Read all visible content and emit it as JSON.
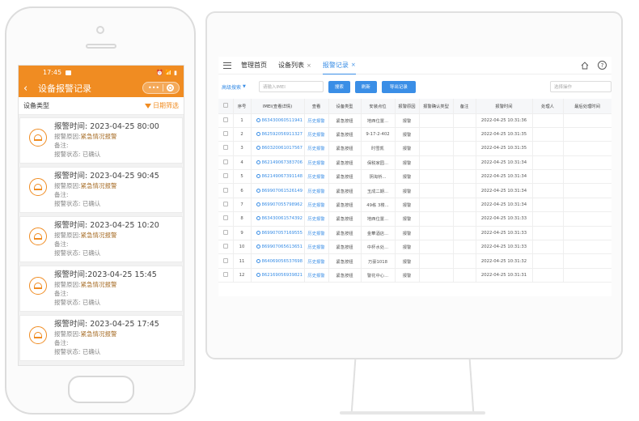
{
  "phone": {
    "status_time": "17:45",
    "status_right": "⏰ 📶 ▮",
    "title": "设备报警记录",
    "capsule_dots": "•••",
    "filter_label": "设备类型",
    "date_filter_label": "日期筛选",
    "records": [
      {
        "time": "报警时间:  2023-04-25  80:00",
        "reason_label": "报警原因:",
        "reason": "紧急情况报警",
        "remark": "备注:",
        "status": "报警状态: 已确认"
      },
      {
        "time": "报警时间:  2023-04-25  90:45",
        "reason_label": "报警原因:",
        "reason": "紧急情况报警",
        "remark": "备注:",
        "status": "报警状态: 已确认"
      },
      {
        "time": "报警时间:  2023-04-25  10:20",
        "reason_label": "报警原因:",
        "reason": "紧急情况报警",
        "remark": "备注:",
        "status": "报警状态: 已确认"
      },
      {
        "time": "报警时间:2023-04-25  15:45",
        "reason_label": "报警原因:",
        "reason": "紧急情况报警",
        "remark": "备注:",
        "status": "报警状态: 已确认"
      },
      {
        "time": "报警时间:  2023-04-25  17:45",
        "reason_label": "报警原因:",
        "reason": "紧急情况报警",
        "remark": "备注:",
        "status": "报警状态: 已确认"
      }
    ]
  },
  "desktop": {
    "tabs": [
      {
        "label": "管理首页",
        "closable": false
      },
      {
        "label": "设备列表",
        "closable": true
      },
      {
        "label": "报警记录",
        "closable": true
      }
    ],
    "close_glyph": "×",
    "help_glyph": "?",
    "toolbar": {
      "advanced_search": "高级搜索",
      "search_placeholder": "请输入IMEI",
      "search_btn": "搜索",
      "refresh_btn": "刷新",
      "export_btn": "导出记录",
      "op_placeholder": "选择操作"
    },
    "table": {
      "headers": [
        "",
        "序号",
        "IMEI(查看详情)",
        "查看",
        "设备类型",
        "安装点位",
        "报警原因",
        "报警确认类型",
        "备注",
        "报警时间",
        "处理人",
        "最后处理时间"
      ],
      "rows": [
        {
          "no": "1",
          "imei": "863430060511941",
          "view": "历史报警",
          "type": "紧急按钮",
          "loc": "地西位置...",
          "reason": "报警",
          "confirm": "",
          "remark": "",
          "time": "2022-04-25 10:31:36",
          "handler": "",
          "last": ""
        },
        {
          "no": "2",
          "imei": "862592056911327",
          "view": "历史报警",
          "type": "紧急按钮",
          "loc": "9-17-2-402",
          "reason": "报警",
          "confirm": "",
          "remark": "",
          "time": "2022-04-25 10:31:35",
          "handler": "",
          "last": ""
        },
        {
          "no": "3",
          "imei": "860320061017567",
          "view": "历史报警",
          "type": "紧急按钮",
          "loc": "时雪凯",
          "reason": "报警",
          "confirm": "",
          "remark": "",
          "time": "2022-04-25 10:31:35",
          "handler": "",
          "last": ""
        },
        {
          "no": "4",
          "imei": "862149067383706",
          "view": "历史报警",
          "type": "紧急按钮",
          "loc": "保税家园...",
          "reason": "报警",
          "confirm": "",
          "remark": "",
          "time": "2022-04-25 10:31:34",
          "handler": "",
          "last": ""
        },
        {
          "no": "5",
          "imei": "862149067391148",
          "view": "历史报警",
          "type": "紧急按钮",
          "loc": "阴淘桥...",
          "reason": "报警",
          "confirm": "",
          "remark": "",
          "time": "2022-04-25 10:31:34",
          "handler": "",
          "last": ""
        },
        {
          "no": "6",
          "imei": "869907061526149",
          "view": "历史报警",
          "type": "紧急按钮",
          "loc": "玉成二期...",
          "reason": "报警",
          "confirm": "",
          "remark": "",
          "time": "2022-04-25 10:31:34",
          "handler": "",
          "last": ""
        },
        {
          "no": "7",
          "imei": "869907055798962",
          "view": "历史报警",
          "type": "紧急按钮",
          "loc": "49栋 3楼...",
          "reason": "报警",
          "confirm": "",
          "remark": "",
          "time": "2022-04-25 10:31:34",
          "handler": "",
          "last": ""
        },
        {
          "no": "8",
          "imei": "863430061574392",
          "view": "历史报警",
          "type": "紧急按钮",
          "loc": "地西位置...",
          "reason": "报警",
          "confirm": "",
          "remark": "",
          "time": "2022-04-25 10:31:33",
          "handler": "",
          "last": ""
        },
        {
          "no": "9",
          "imei": "869907057169555",
          "view": "历史报警",
          "type": "紧急按钮",
          "loc": "金華酒店...",
          "reason": "报警",
          "confirm": "",
          "remark": "",
          "time": "2022-04-25 10:31:33",
          "handler": "",
          "last": ""
        },
        {
          "no": "10",
          "imei": "869907065613651",
          "view": "历史报警",
          "type": "紧急按钮",
          "loc": "中杯水处...",
          "reason": "报警",
          "confirm": "",
          "remark": "",
          "time": "2022-04-25 10:31:33",
          "handler": "",
          "last": ""
        },
        {
          "no": "11",
          "imei": "864069056537698",
          "view": "历史报警",
          "type": "紧急按钮",
          "loc": "万豪1018",
          "reason": "报警",
          "confirm": "",
          "remark": "",
          "time": "2022-04-25 10:31:32",
          "handler": "",
          "last": ""
        },
        {
          "no": "12",
          "imei": "862169056939821",
          "view": "历史报警",
          "type": "紧急按钮",
          "loc": "警花中心...",
          "reason": "报警",
          "confirm": "",
          "remark": "",
          "time": "2022-04-25 10:31:31",
          "handler": "",
          "last": ""
        }
      ]
    }
  }
}
